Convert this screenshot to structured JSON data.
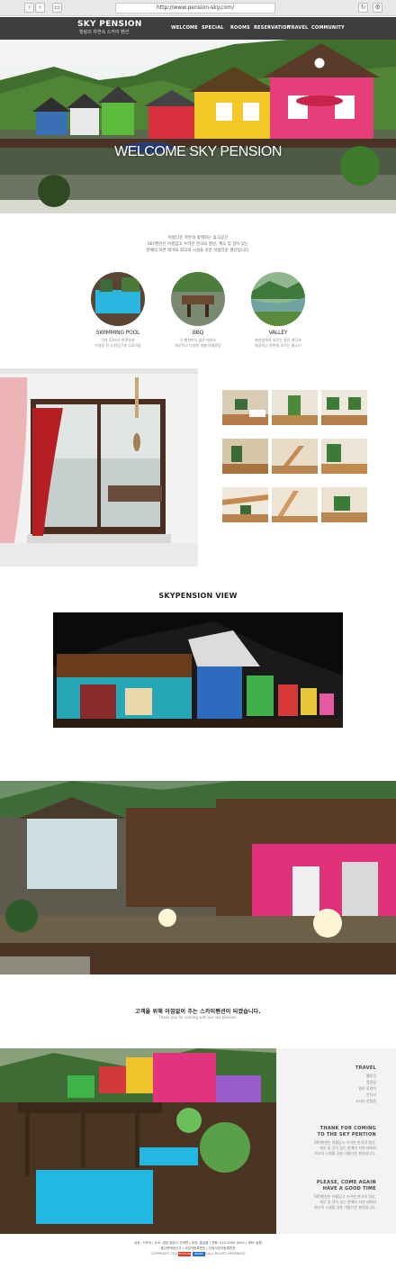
{
  "browser": {
    "url": "http://www.pension-sky.com/",
    "back": "‹",
    "forward": "›",
    "tab_icon": "▭",
    "reload_icon": "↻",
    "settings_icon": "⚙"
  },
  "header": {
    "logo": "SKY PENSION",
    "logo_sub": "힐링의 자연속 스카이 펜션",
    "nav": [
      "WELCOME",
      "SPECIAL",
      "ROOMS",
      "RESERVATION",
      "TRAVEL",
      "COMMUNITY"
    ]
  },
  "hero": {
    "title": "WELCOME SKY PENSION"
  },
  "intro": {
    "line1": "아름다운 자연과 함께하는 휴식공간",
    "line2": "SKY펜션은 아름답고 수려한 한국의 명산, 계곡 및 강이 있는",
    "line3": "한예의 자연 테마와 최고의 시설을 갖춘 아름다운 펜션입니다."
  },
  "features": [
    {
      "title": "SWIMMING POOL",
      "desc1": "각자 22m의 현관부분",
      "desc2": "수영장 전 노천공간과 무료이용"
    },
    {
      "title": "BBQ",
      "desc1": "각 펜션마다 넓은 테라스",
      "desc2": "깨끗하고 다양한 개별 바베큐장"
    },
    {
      "title": "VALLEY",
      "desc1": "펜션앞에서 흐르는 맑은 계곡과",
      "desc2": "깨끗하고 한번데 흐르는 물소리"
    }
  ],
  "view": {
    "title": "SKYPENSION VIEW"
  },
  "thanks": {
    "ko": "고객을 위해 아낌없이 주는 스카이펜션이 되겠습니다.",
    "en": "Thank you for coming with our sky pension."
  },
  "sidebar": {
    "travel_title": "TRAVEL",
    "travel_items": [
      "웰빙길",
      "알알길",
      "알로 휴양지",
      "언덕사",
      "고사리 산림원"
    ],
    "thank_title1": "THANK FOR COMING",
    "thank_title2": "TO THE SKY PENTION",
    "thank_text1": "SKY펜션은 아름답고 수려한 한국의 명산,",
    "thank_text2": "계곡 및 강이 있는 한예의 자연 테마와",
    "thank_text3": "최고의 시설을 갖춘 아름다운 펜션입니다.",
    "please_title1": "PLEASE, COME AGAIN",
    "please_title2": "HAVE A GOOD TIME",
    "please_text1": "SKY펜션은 아름답고 수려한 한국의 명산,",
    "please_text2": "계곡 및 강이 있는 한예의 자연 테마와",
    "please_text3": "최고의 시설을 갖춘 아름다운 펜션입니다."
  },
  "footer": {
    "line1": "상호: 스카이 | 주소: 경남 밀양시 산외면 | 대표: 홍길동 | 전화: 010-0000-0000 | 계좌: 농협",
    "line2": "통신판매업신고 | 사업자등록번호 | 관광사업자등록번호",
    "copyright": "COPYRIGHT 2015 (C) SKY PENSION ALL RIGHTS RESERVED",
    "badge1": "ESCROW",
    "badge2": "KBANK"
  }
}
